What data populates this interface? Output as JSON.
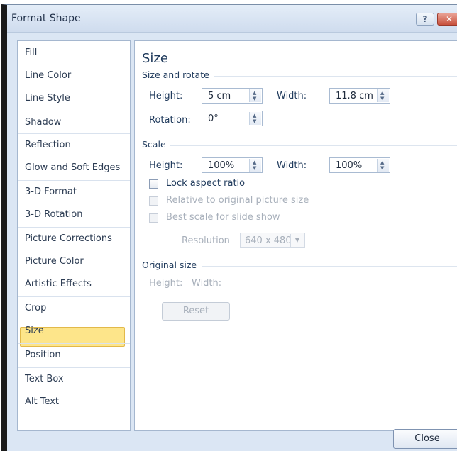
{
  "window": {
    "title": "Format Shape",
    "help_symbol": "?",
    "close_symbol": "✕"
  },
  "nav": {
    "items": [
      "Fill",
      "Line Color",
      "Line Style",
      "Shadow",
      "Reflection",
      "Glow and Soft Edges",
      "3-D Format",
      "3-D Rotation",
      "Picture Corrections",
      "Picture Color",
      "Artistic Effects",
      "Crop",
      "Size",
      "Position",
      "Text Box",
      "Alt Text"
    ],
    "selected": "Size"
  },
  "panel": {
    "heading": "Size",
    "size_and_rotate": {
      "label": "Size and rotate",
      "height_label": "Height:",
      "height_value": "5 cm",
      "width_label": "Width:",
      "width_value": "11.8 cm",
      "rotation_label": "Rotation:",
      "rotation_value": "0°"
    },
    "scale": {
      "label": "Scale",
      "height_label": "Height:",
      "height_value": "100%",
      "width_label": "Width:",
      "width_value": "100%",
      "lock_aspect_label": "Lock aspect ratio",
      "relative_label": "Relative to original picture size",
      "best_scale_label": "Best scale for slide show",
      "resolution_label": "Resolution",
      "resolution_value": "640 x 480"
    },
    "original_size": {
      "label": "Original size",
      "height_label": "Height:",
      "width_label": "Width:",
      "reset_label": "Reset"
    }
  },
  "footer": {
    "close_label": "Close"
  },
  "colors": {
    "selected_bg": "#fde58a",
    "dialog_bg": "#dbe6f4",
    "text": "#1e395b",
    "disabled": "#a8b0bb"
  }
}
